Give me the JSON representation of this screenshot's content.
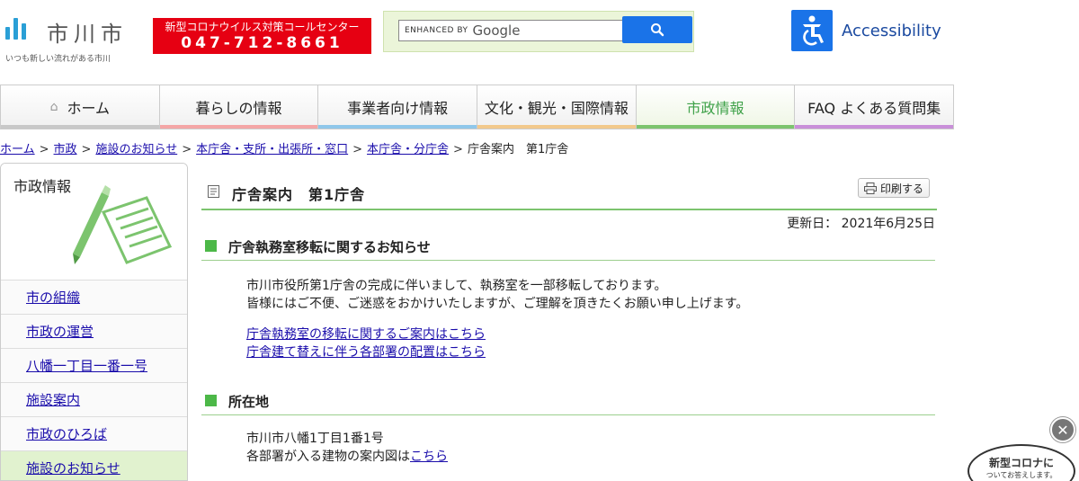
{
  "header": {
    "logo_text": "市川市",
    "slogan": "いつも新しい流れがある市川",
    "corona_banner_line1": "新型コロナウイルス対策コールセンター",
    "corona_banner_phone": "047-712-8661",
    "search_enhanced": "ENHANCED BY",
    "search_google": "Google",
    "accessibility_label": "Accessibility"
  },
  "nav": {
    "items": [
      {
        "label": "ホーム"
      },
      {
        "label": "暮らしの情報"
      },
      {
        "label": "事業者向け情報"
      },
      {
        "label": "文化・観光・国際情報"
      },
      {
        "label": "市政情報"
      },
      {
        "label": "FAQ よくある質問集"
      }
    ],
    "strip_colors": [
      "#c8c8c8",
      "#f4a6a6",
      "#8fc7ea",
      "#f2c98c",
      "#7cc46e",
      "#c98fd9"
    ],
    "active_color": "#40a24a"
  },
  "breadcrumb": {
    "items": [
      "ホーム",
      "市政",
      "施設のお知らせ",
      "本庁舎・支所・出張所・窓口",
      "本庁舎・分庁舎"
    ],
    "current": "庁舎案内　第1庁舎"
  },
  "sidebar": {
    "title": "市政情報",
    "items": [
      {
        "label": "市の組織"
      },
      {
        "label": "市政の運営"
      },
      {
        "label": "八幡一丁目一番一号"
      },
      {
        "label": "施設案内"
      },
      {
        "label": "市政のひろば"
      },
      {
        "label": "施設のお知らせ"
      }
    ]
  },
  "main": {
    "title": "庁舎案内　第1庁舎",
    "print_label": "印刷する",
    "updated": "更新日：  2021年6月25日",
    "section1": {
      "heading": "庁舎執務室移転に関するお知らせ",
      "line1": "市川市役所第1庁舎の完成に伴いまして、執務室を一部移転しております。",
      "line2": "皆様にはご不便、ご迷惑をおかけいたしますが、ご理解を頂きたくお願い申し上げます。",
      "link1": "庁舎執務室の移転に関するご案内はこちら",
      "link2": "庁舎建て替えに伴う各部署の配置はこちら"
    },
    "section2": {
      "heading": "所在地",
      "address": "市川市八幡1丁目1番1号",
      "guide_prefix": "各部署が入る建物の案内図は",
      "guide_link": "こちら"
    }
  },
  "floating": {
    "badge_line1": "新型コロナに",
    "badge_line2": "ついてお答えします。",
    "close_symbol": "✕"
  },
  "colors": {
    "accent_green": "#4cb848",
    "banner_red": "#e60012",
    "google_blue": "#1a73e8"
  }
}
